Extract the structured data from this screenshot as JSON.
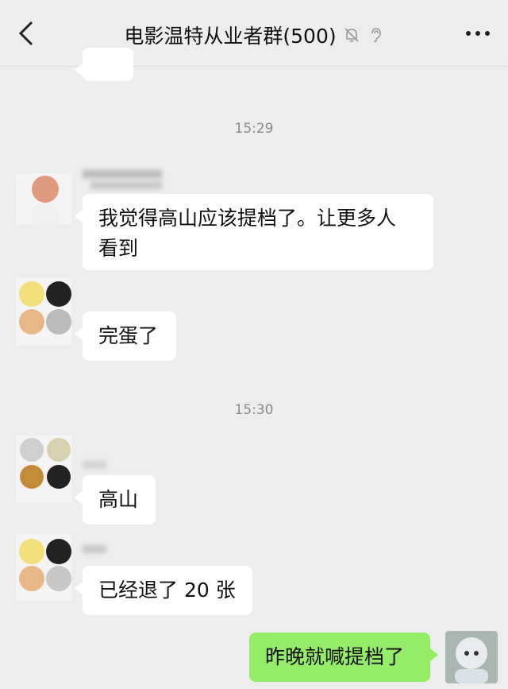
{
  "header": {
    "title": "电影温特从业者群(500)",
    "back_icon": "chevron-left-icon",
    "mute_icon": "bell-slash-icon",
    "ear_icon": "ear-icon",
    "more_icon": "more-dots-icon"
  },
  "timestamps": [
    "15:29",
    "15:30"
  ],
  "messages": [
    {
      "id": 1,
      "text": "我觉得高山应该提档了。让更多人\n看到"
    },
    {
      "id": 2,
      "text": "完蛋了"
    },
    {
      "id": 3,
      "text": "高山"
    },
    {
      "id": 4,
      "text": "已经退了 20 张"
    },
    {
      "id": 5,
      "text": "昨晚就喊提档了"
    }
  ],
  "colors": {
    "background": "#ededed",
    "bubble_other": "#ffffff",
    "bubble_self": "#95ec69"
  }
}
